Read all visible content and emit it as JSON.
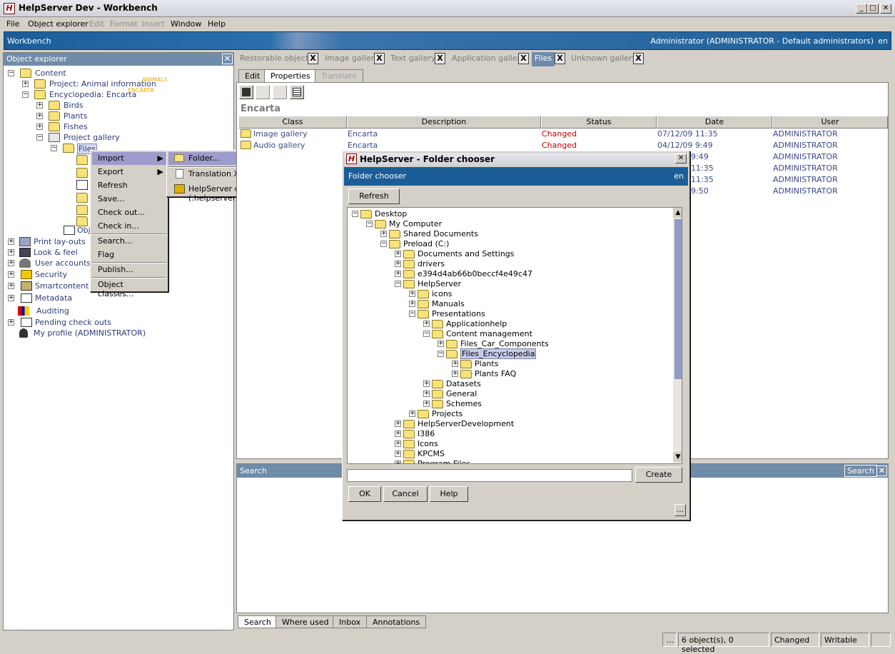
{
  "window": {
    "title": "HelpServer Dev - Workbench",
    "app_icon": "H"
  },
  "menu": [
    {
      "label": "File",
      "enabled": true
    },
    {
      "label": "Object explorer",
      "enabled": true
    },
    {
      "label": "Edit",
      "enabled": false
    },
    {
      "label": "Format",
      "enabled": false
    },
    {
      "label": "Insert",
      "enabled": false
    },
    {
      "label": "Window",
      "enabled": true
    },
    {
      "label": "Help",
      "enabled": true
    }
  ],
  "workbench": {
    "title": "Workbench",
    "user": "Administrator (ADMINISTRATOR - Default administrators)",
    "lang": "en"
  },
  "explorer": {
    "title": "Object explorer",
    "tree": [
      {
        "label": "Content"
      },
      {
        "label": "Project: Animal information",
        "tag": "ANIMALS"
      },
      {
        "label": "Encyclopedia: Encarta",
        "tag": "ENCARTA"
      },
      {
        "label": "Birds"
      },
      {
        "label": "Plants"
      },
      {
        "label": "Fishes"
      },
      {
        "label": "Project gallery"
      },
      {
        "label": "Files"
      },
      {
        "label": "Obje"
      },
      {
        "label": "Print lay-outs"
      },
      {
        "label": "Look & feel"
      },
      {
        "label": "User accounts"
      },
      {
        "label": "Security"
      },
      {
        "label": "Smartcontent"
      },
      {
        "label": "Metadata"
      },
      {
        "label": "Auditing"
      },
      {
        "label": "Pending check outs"
      },
      {
        "label": "My profile (ADMINISTRATOR)"
      }
    ]
  },
  "context_menu": {
    "items": [
      "Import",
      "Export",
      "Refresh",
      "Save...",
      "Check out...",
      "Check in...",
      "Search...",
      "Flag",
      "Publish...",
      "Object classes..."
    ],
    "import_submenu": [
      "Folder...",
      "Translation XML (.xml)...",
      "HelpServer objects (.helpserver)..."
    ]
  },
  "gallery_tabs": [
    {
      "label": "Restorable objects",
      "active": false
    },
    {
      "label": "Image gallery",
      "active": false
    },
    {
      "label": "Text gallery",
      "active": false
    },
    {
      "label": "Application gallery",
      "active": false
    },
    {
      "label": "Files",
      "active": true
    },
    {
      "label": "Unknown gallery",
      "active": false
    }
  ],
  "close_glyph": "X",
  "sub_tabs": [
    {
      "label": "Edit",
      "state": "normal"
    },
    {
      "label": "Properties",
      "state": "active"
    },
    {
      "label": "Translate",
      "state": "disabled"
    }
  ],
  "breadcrumb": "Encarta",
  "table": {
    "columns": [
      "Class",
      "Description",
      "Status",
      "Date",
      "User"
    ],
    "rows": [
      {
        "cls": "Image gallery",
        "desc": "Encarta",
        "status": "Changed",
        "date": "07/12/09 11:35",
        "user": "ADMINISTRATOR"
      },
      {
        "cls": "Audio gallery",
        "desc": "Encarta",
        "status": "Changed",
        "date": "04/12/09 9:49",
        "user": "ADMINISTRATOR"
      },
      {
        "cls": "",
        "desc": "",
        "status": "",
        "date": "9:49",
        "user": "ADMINISTRATOR"
      },
      {
        "cls": "",
        "desc": "",
        "status": "",
        "date": "11:35",
        "user": "ADMINISTRATOR"
      },
      {
        "cls": "",
        "desc": "",
        "status": "",
        "date": "11:35",
        "user": "ADMINISTRATOR"
      },
      {
        "cls": "",
        "desc": "",
        "status": "",
        "date": "9:50",
        "user": "ADMINISTRATOR"
      }
    ]
  },
  "search": {
    "title": "Search",
    "button": "Search"
  },
  "bottom_tabs": [
    "Search",
    "Where used",
    "Inbox",
    "Annotations"
  ],
  "status": {
    "dots": "...",
    "objects": "6 object(s), 0 selected",
    "state": "Changed",
    "mode": "Writable"
  },
  "dialog": {
    "title": "HelpServer - Folder chooser",
    "header": "Folder chooser",
    "lang": "en",
    "refresh": "Refresh",
    "create": "Create",
    "ok": "OK",
    "cancel": "Cancel",
    "help": "Help",
    "more": "...",
    "input_value": "",
    "tree": [
      {
        "label": "Desktop",
        "d": 0,
        "exp": "-"
      },
      {
        "label": "My Computer",
        "d": 1,
        "exp": "-"
      },
      {
        "label": "Shared Documents",
        "d": 2,
        "exp": "+"
      },
      {
        "label": "Preload (C:)",
        "d": 2,
        "exp": "-"
      },
      {
        "label": "Documents and Settings",
        "d": 3,
        "exp": "+"
      },
      {
        "label": "drivers",
        "d": 3,
        "exp": "+"
      },
      {
        "label": "e394d4ab66b0beccf4e49c47",
        "d": 3,
        "exp": "+"
      },
      {
        "label": "HelpServer",
        "d": 3,
        "exp": "-"
      },
      {
        "label": "icons",
        "d": 4,
        "exp": "+"
      },
      {
        "label": "Manuals",
        "d": 4,
        "exp": "+"
      },
      {
        "label": "Presentations",
        "d": 4,
        "exp": "-"
      },
      {
        "label": "Applicationhelp",
        "d": 5,
        "exp": "+"
      },
      {
        "label": "Content management",
        "d": 5,
        "exp": "-"
      },
      {
        "label": "Files_Car_Components",
        "d": 6,
        "exp": "+"
      },
      {
        "label": "Files_Encyclopedia",
        "d": 6,
        "exp": "-",
        "selected": true
      },
      {
        "label": "Plants",
        "d": 7,
        "exp": "+"
      },
      {
        "label": "Plants FAQ",
        "d": 7,
        "exp": "+"
      },
      {
        "label": "Datasets",
        "d": 5,
        "exp": "+"
      },
      {
        "label": "General",
        "d": 5,
        "exp": "+"
      },
      {
        "label": "Schemes",
        "d": 5,
        "exp": "+"
      },
      {
        "label": "Projects",
        "d": 4,
        "exp": "+"
      },
      {
        "label": "HelpServerDevelopment",
        "d": 3,
        "exp": "+"
      },
      {
        "label": "I386",
        "d": 3,
        "exp": "+"
      },
      {
        "label": "Icons",
        "d": 3,
        "exp": "+"
      },
      {
        "label": "KPCMS",
        "d": 3,
        "exp": "+"
      },
      {
        "label": "Program Files",
        "d": 3,
        "exp": "+"
      }
    ]
  }
}
